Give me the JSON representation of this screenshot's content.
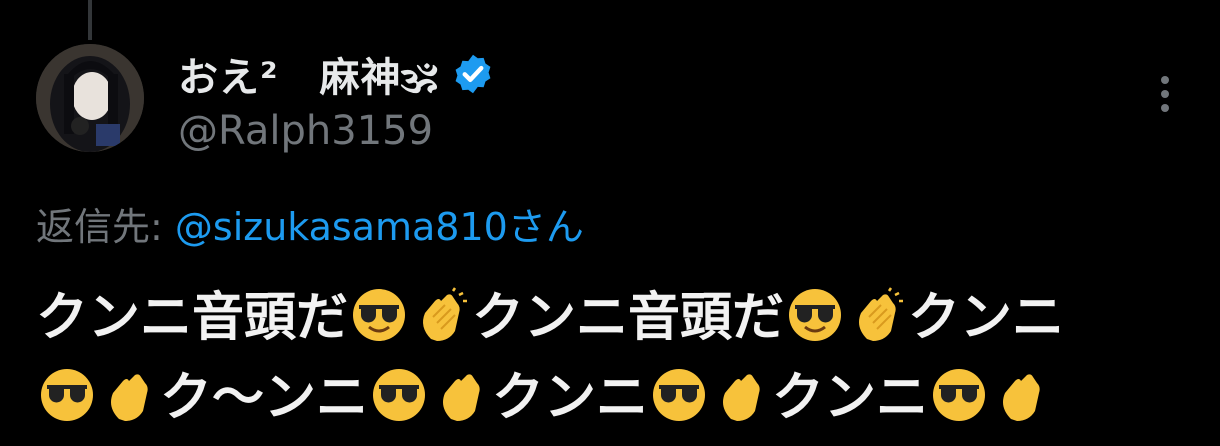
{
  "tweet": {
    "display_name": "おえ²　麻神🕉",
    "handle": "@Ralph3159",
    "reply_prefix": "返信先: ",
    "reply_mention": "@sizukasama810さん",
    "text_line1": [
      "クンニ音頭だ",
      "😎",
      "👏",
      "クンニ音頭だ",
      "😎",
      "👏",
      "クンニ"
    ],
    "text_line2": [
      "😎",
      "👏",
      "ク〜ンニ",
      "😎",
      "👏",
      "クンニ",
      "😎",
      "👏",
      "クンニ",
      "😎",
      "👏"
    ]
  },
  "icons": {
    "verified": "verified-badge-icon",
    "more": "more-vertical-icon"
  },
  "colors": {
    "background": "#000000",
    "text": "#e7e9ea",
    "secondary": "#71767b",
    "accent": "#1d9bf0"
  }
}
